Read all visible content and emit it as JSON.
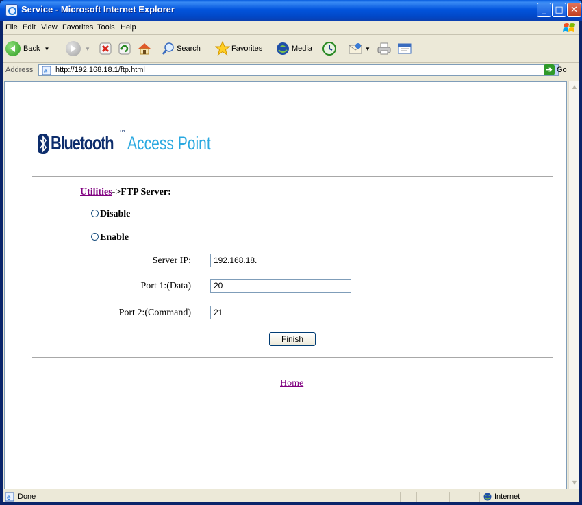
{
  "window": {
    "title": "Service - Microsoft Internet Explorer"
  },
  "menu": [
    "File",
    "Edit",
    "View",
    "Favorites",
    "Tools",
    "Help"
  ],
  "toolbar": {
    "back": "Back",
    "search": "Search",
    "favorites": "Favorites",
    "media": "Media"
  },
  "address": {
    "label": "Address",
    "url": "http://192.168.18.1/ftp.html",
    "go": "Go"
  },
  "logo": {
    "brand": "Bluetooth",
    "tm": "™",
    "product": "Access Point"
  },
  "page": {
    "breadcrumb_link": "Utilities",
    "breadcrumb_rest": "->FTP Server:",
    "options": [
      "Disable",
      "Enable"
    ],
    "fields": [
      {
        "label": "Server IP:",
        "value": "192.168.18."
      },
      {
        "label": "Port 1:(Data)",
        "value": "20"
      },
      {
        "label": "Port 2:(Command)",
        "value": "21"
      }
    ],
    "finish": "Finish",
    "home": "Home"
  },
  "status": {
    "text": "Done",
    "zone": "Internet"
  },
  "colors": {
    "link": "#800080",
    "titlebar": "#0355dd",
    "logo_dark": "#0d2d6c",
    "logo_light": "#29a8e0"
  }
}
